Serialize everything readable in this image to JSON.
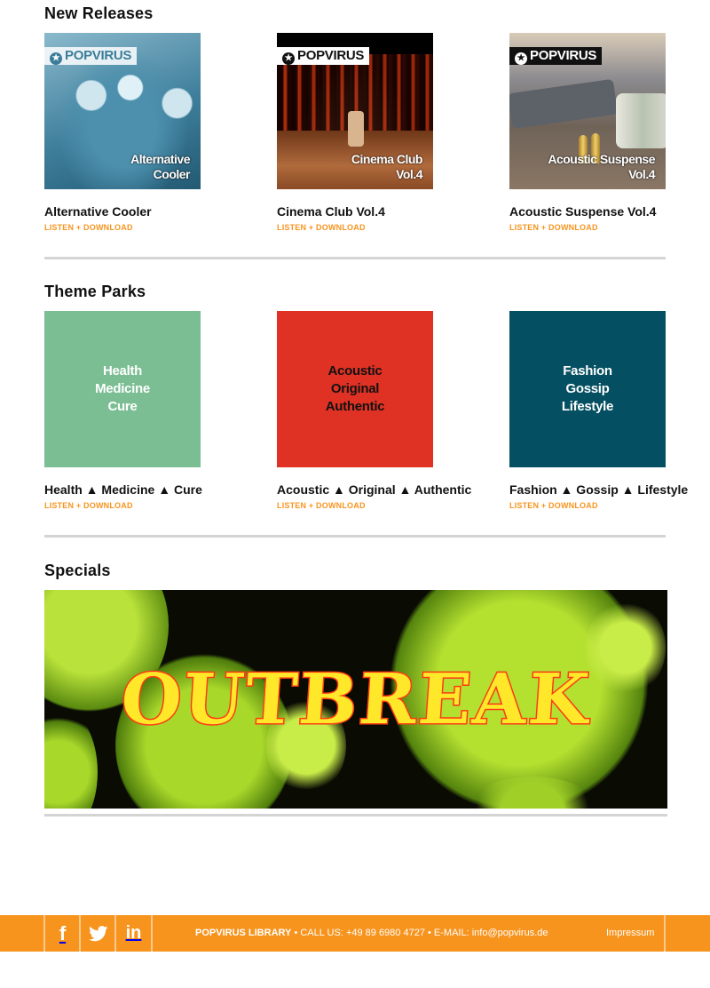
{
  "sections": {
    "new_releases": {
      "title": "New Releases",
      "items": [
        {
          "title": "Alternative Cooler",
          "cover_caption": [
            "Alternative",
            "Cooler"
          ],
          "brand": "POPVIRUS",
          "link": "LISTEN + DOWNLOAD"
        },
        {
          "title": "Cinema Club Vol.4",
          "cover_caption": [
            "Cinema Club",
            "Vol.4"
          ],
          "brand": "POPVIRUS",
          "link": "LISTEN + DOWNLOAD"
        },
        {
          "title": "Acoustic Suspense Vol.4",
          "cover_caption": [
            "Acoustic Suspense",
            "Vol.4"
          ],
          "brand": "POPVIRUS",
          "link": "LISTEN + DOWNLOAD"
        }
      ]
    },
    "theme_parks": {
      "title": "Theme Parks",
      "items": [
        {
          "title": "Health ▲ Medicine ▲ Cure",
          "cover_lines": [
            "Health",
            "Medicine",
            "Cure"
          ],
          "color": "#7bbe93",
          "text_color": "#ffffff",
          "link": "LISTEN + DOWNLOAD"
        },
        {
          "title": "Acoustic ▲ Original ▲ Authentic",
          "cover_lines": [
            "Acoustic",
            "Original",
            "Authentic"
          ],
          "color": "#e03224",
          "text_color": "#111111",
          "link": "LISTEN + DOWNLOAD"
        },
        {
          "title": "Fashion ▲ Gossip ▲ Lifestyle",
          "cover_lines": [
            "Fashion",
            "Gossip",
            "Lifestyle"
          ],
          "color": "#054f62",
          "text_color": "#ffffff",
          "link": "LISTEN + DOWNLOAD"
        }
      ]
    },
    "specials": {
      "title": "Specials",
      "banner_text": "OUTBREAK"
    }
  },
  "footer": {
    "social": [
      {
        "name": "facebook",
        "glyph": "f"
      },
      {
        "name": "twitter",
        "glyph": "twitter-bird"
      },
      {
        "name": "linkedin",
        "glyph": "in"
      }
    ],
    "brand": "POPVIRUS LIBRARY",
    "separator": " • ",
    "call_label": "CALL US:",
    "phone": "+49 89 6980 4727",
    "email_label": "E-MAIL:",
    "email": "info@popvirus.de",
    "impressum": "Impressum"
  },
  "colors": {
    "accent": "#f7941e",
    "divider": "#d4d4d4"
  }
}
